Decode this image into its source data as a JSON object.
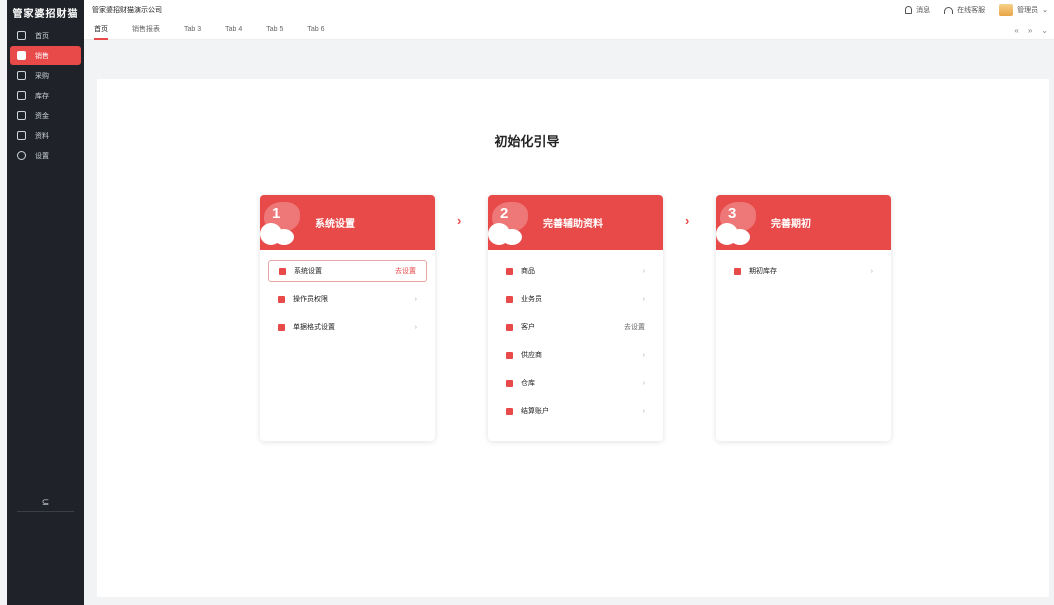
{
  "sidebar": {
    "logo": "管家婆招财猫",
    "items": [
      {
        "label": "首页",
        "icon": "home-icon"
      },
      {
        "label": "销售",
        "icon": "sales-icon"
      },
      {
        "label": "采购",
        "icon": "purchase-icon"
      },
      {
        "label": "库存",
        "icon": "inventory-icon"
      },
      {
        "label": "资金",
        "icon": "funds-icon"
      },
      {
        "label": "资料",
        "icon": "data-icon"
      },
      {
        "label": "设置",
        "icon": "settings-icon"
      }
    ],
    "collapse": "⊆"
  },
  "header": {
    "company": "管家婆招财猫演示公司",
    "message": "消息",
    "support": "在线客服",
    "user": "管理员"
  },
  "tabs": [
    "首页",
    "销售报表",
    "Tab 3",
    "Tab 4",
    "Tab 5",
    "Tab 6"
  ],
  "tab_controls": {
    "prev": "«",
    "next": "»",
    "menu": "⌄"
  },
  "guide": {
    "title": "初始化引导",
    "step_arrow": "›",
    "cards": [
      {
        "num": "1",
        "title": "系统设置",
        "rows": [
          {
            "label": "系统设置",
            "action": "去设置"
          },
          {
            "label": "操作员权限",
            "action": "›"
          },
          {
            "label": "单据格式设置",
            "action": "›"
          }
        ]
      },
      {
        "num": "2",
        "title": "完善辅助资料",
        "rows": [
          {
            "label": "商品",
            "action": "›"
          },
          {
            "label": "业务员",
            "action": "›"
          },
          {
            "label": "客户",
            "action": "去设置"
          },
          {
            "label": "供应商",
            "action": "›"
          },
          {
            "label": "仓库",
            "action": "›"
          },
          {
            "label": "结算账户",
            "action": "›"
          }
        ]
      },
      {
        "num": "3",
        "title": "完善期初",
        "rows": [
          {
            "label": "期初库存",
            "action": "›"
          }
        ]
      }
    ]
  },
  "colors": {
    "accent": "#e84a4a",
    "sidebar": "#1f2329"
  }
}
